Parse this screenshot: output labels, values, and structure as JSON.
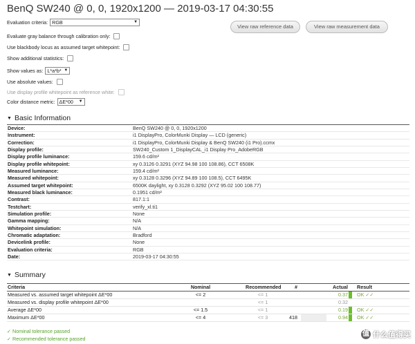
{
  "title": "BenQ SW240 @ 0, 0, 1920x1200 — 2019-03-17 04:30:55",
  "options": {
    "evaluation_criteria_label": "Evaluation criteria:",
    "evaluation_criteria_value": "RGB",
    "gray_balance": "Evaluate gray balance through calibration only:",
    "blackbody": "Use blackbody locus as assumed target whitepoint:",
    "additional_stats": "Show additional statistics:",
    "show_values_label": "Show values as:",
    "show_values_value": "L*a*b*",
    "absolute_values": "Use absolute values:",
    "display_profile_wp": "Use display profile whitepoint as reference white:",
    "color_distance_label": "Color distance metric:",
    "color_distance_value": "ΔE*00"
  },
  "buttons": {
    "raw_reference": "View raw reference data",
    "raw_measurement": "View raw measurement data"
  },
  "basic_info": {
    "title": "Basic Information",
    "rows": [
      {
        "k": "Device:",
        "v": "BenQ SW240 @ 0, 0, 1920x1200"
      },
      {
        "k": "Instrument:",
        "v": "i1 DisplayPro, ColorMunki Display — LCD (generic)"
      },
      {
        "k": "Correction:",
        "v": "i1 DisplayPro, ColorMunki Display & BenQ SW240 (i1 Pro).ccmx"
      },
      {
        "k": "Display profile:",
        "v": "SW240_Custom 1_DisplayCAL_i1 Display Pro_AdobeRGB"
      },
      {
        "k": "Display profile luminance:",
        "v": "159.6 cd/m²"
      },
      {
        "k": "Display profile whitepoint:",
        "v": "xy 0.3126 0.3291 (XYZ 94.98 100 108.86), CCT 6508K"
      },
      {
        "k": "Measured luminance:",
        "v": "159.4 cd/m²"
      },
      {
        "k": "Measured whitepoint:",
        "v": "xy 0.3128 0.3296 (XYZ 94.89 100 108.5), CCT 6495K"
      },
      {
        "k": "Assumed target whitepoint:",
        "v": "6500K daylight, xy 0.3128 0.3292 (XYZ 95.02 100 108.77)"
      },
      {
        "k": "Measured black luminance:",
        "v": "0.1951 cd/m²"
      },
      {
        "k": "Contrast:",
        "v": "817.1:1"
      },
      {
        "k": "Testchart:",
        "v": "verify_xl.ti1"
      },
      {
        "k": "Simulation profile:",
        "v": "None"
      },
      {
        "k": "Gamma mapping:",
        "v": "N/A"
      },
      {
        "k": "Whitepoint simulation:",
        "v": "N/A"
      },
      {
        "k": "Chromatic adaptation:",
        "v": "Bradford"
      },
      {
        "k": "Devicelink profile:",
        "v": "None"
      },
      {
        "k": "Evaluation criteria:",
        "v": "RGB"
      },
      {
        "k": "Date:",
        "v": "2019-03-17 04:30:55"
      }
    ]
  },
  "summary": {
    "title": "Summary",
    "headers": {
      "criteria": "Criteria",
      "nominal": "Nominal",
      "recommended": "Recommended",
      "num": "#",
      "actual": "Actual",
      "result": "Result"
    },
    "rows": [
      {
        "criteria": "Measured vs. assumed target whitepoint ΔE*00",
        "nominal": "<= 2",
        "recommended": "<= 1",
        "num": "",
        "actual": "0.37",
        "result": "OK ✓✓",
        "indicator": "#6abf2a"
      },
      {
        "criteria": "Measured vs. display profile whitepoint ΔE*00",
        "nominal": "",
        "recommended": "<= 1",
        "num": "",
        "actual": "0.32",
        "result": "",
        "indicator": ""
      },
      {
        "criteria": "Average ΔE*00",
        "nominal": "<= 1.5",
        "recommended": "<= 1",
        "num": "",
        "actual": "0.19",
        "result": "OK ✓✓",
        "indicator": "#6abf2a"
      },
      {
        "criteria": "Maximum ΔE*00",
        "nominal": "<= 4",
        "recommended": "<= 3",
        "num": "418",
        "actual": "0.94",
        "result": "OK ✓✓",
        "indicator": "#6abf2a"
      }
    ],
    "legend": {
      "nominal": "✓ Nominal tolerance passed",
      "recommended": "✓ Recommended tolerance passed"
    }
  },
  "watermark": {
    "logo": "值",
    "text": "什么值得买"
  },
  "colors": {
    "pass_green": "#6abf2a",
    "legend_green": "#55a02a"
  }
}
